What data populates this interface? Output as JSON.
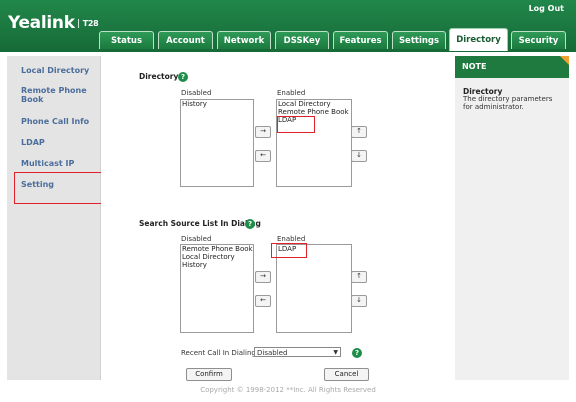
{
  "header": {
    "brand": "Yealink",
    "model": "T28",
    "logout": "Log Out"
  },
  "tabs": [
    {
      "label": "Status"
    },
    {
      "label": "Account"
    },
    {
      "label": "Network"
    },
    {
      "label": "DSSKey"
    },
    {
      "label": "Features"
    },
    {
      "label": "Settings"
    },
    {
      "label": "Directory",
      "active": true
    },
    {
      "label": "Security"
    }
  ],
  "sidebar": {
    "items": [
      {
        "label": "Local Directory"
      },
      {
        "label": "Remote Phone Book"
      },
      {
        "label": "Phone Call Info"
      },
      {
        "label": "LDAP"
      },
      {
        "label": "Multicast IP"
      },
      {
        "label": "Setting",
        "active": true
      }
    ]
  },
  "directory": {
    "title": "Directory",
    "disabled_label": "Disabled",
    "enabled_label": "Enabled",
    "disabled": [
      "History"
    ],
    "enabled": [
      "Local Directory",
      "Remote Phone Book",
      "LDAP"
    ]
  },
  "search": {
    "title": "Search Source List In Dialing",
    "disabled_label": "Disabled",
    "enabled_label": "Enabled",
    "disabled": [
      "Remote Phone Book",
      "Local Directory",
      "History"
    ],
    "enabled": [
      "LDAP"
    ]
  },
  "recent_call": {
    "label": "Recent Call In Dialing",
    "value": "Disabled"
  },
  "buttons": {
    "confirm": "Confirm",
    "cancel": "Cancel",
    "move_right": "→",
    "move_left": "←",
    "move_up": "↑",
    "move_down": "↓"
  },
  "note": {
    "header": "NOTE",
    "title": "Directory",
    "text": "The directory parameters for administrator."
  },
  "footer": "Copyright © 1998-2012 **Inc. All Rights Reserved",
  "colors": {
    "header": "#1b7a3f",
    "highlight": "#e0202a",
    "sidebar_link": "#4c6e9c"
  }
}
